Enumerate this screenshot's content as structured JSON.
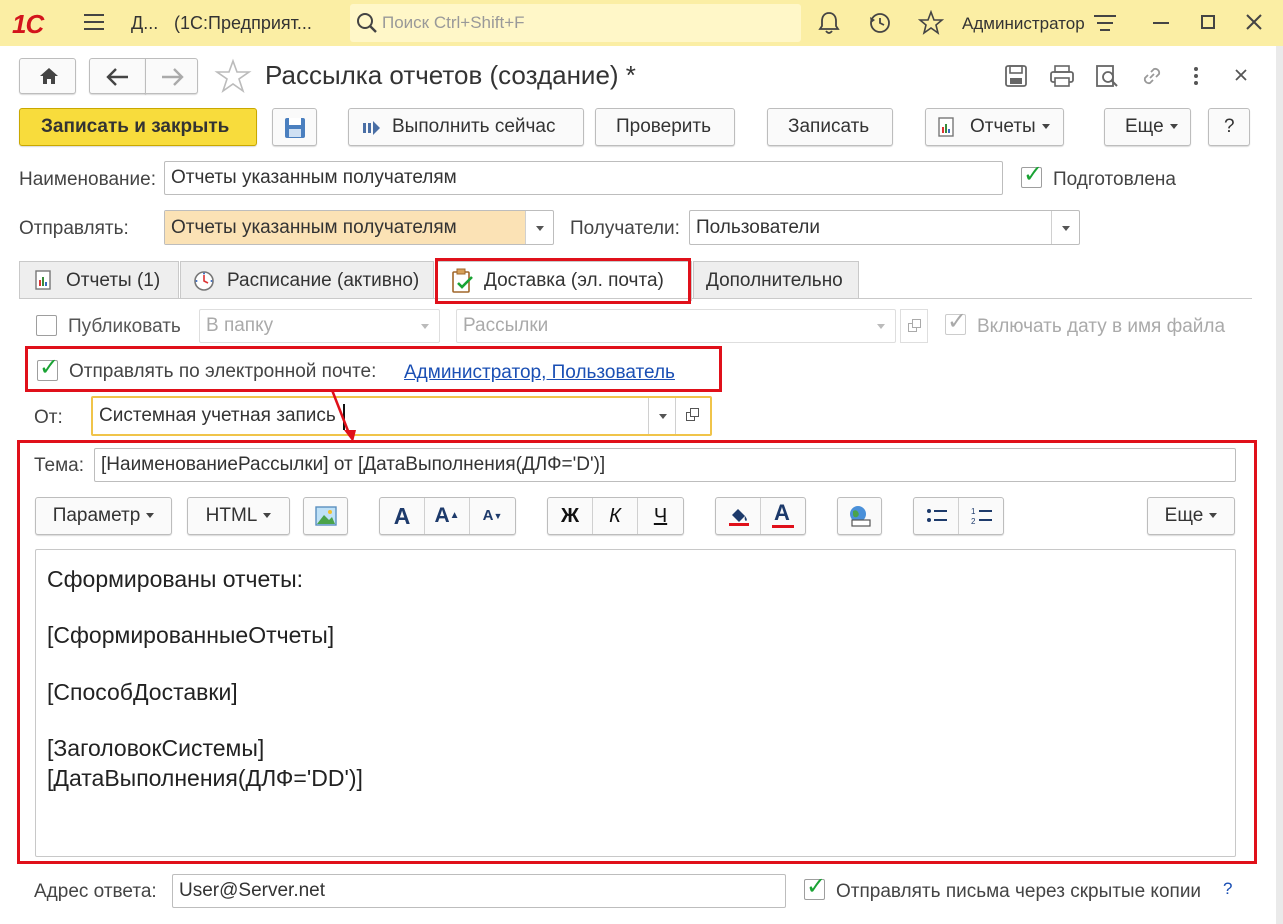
{
  "titlebar": {
    "logo": "1С",
    "short_title": "Д...",
    "app_title": "(1С:Предприят...",
    "search_placeholder": "Поиск Ctrl+Shift+F",
    "user": "Администратор"
  },
  "form": {
    "title": "Рассылка отчетов (создание) *",
    "toolbar": {
      "save_close": "Записать и закрыть",
      "run_now": "Выполнить сейчас",
      "check": "Проверить",
      "save": "Записать",
      "reports": "Отчеты",
      "more": "Еще",
      "help": "?"
    },
    "name_label": "Наименование:",
    "name_value": "Отчеты указанным получателям",
    "prepared_label": "Подготовлена",
    "send_label": "Отправлять:",
    "send_value": "Отчеты указанным получателям",
    "recipients_label": "Получатели:",
    "recipients_value": "Пользователи",
    "tabs": [
      {
        "label": "Отчеты (1)"
      },
      {
        "label": "Расписание (активно)"
      },
      {
        "label": "Доставка (эл. почта)"
      },
      {
        "label": "Дополнительно"
      }
    ],
    "publish_label": "Публиковать",
    "folder_value": "В папку",
    "mailings_value": "Рассылки",
    "include_date_label": "Включать дату в имя файла",
    "email_label": "Отправлять по электронной почте:",
    "email_recipients_link": "Администратор, Пользователь",
    "from_label": "От:",
    "from_value": "Системная учетная запись",
    "subject_label": "Тема:",
    "subject_value": "[НаименованиеРассылки] от [ДатаВыполнения(ДЛФ='D')]",
    "editor_toolbar": {
      "param": "Параметр",
      "html": "HTML",
      "bold": "Ж",
      "italic": "К",
      "underline": "Ч",
      "more": "Еще",
      "font_a": "A",
      "font_inc": "A",
      "font_dec": "A",
      "list_num_label": "1 2"
    },
    "body_lines": [
      "Сформированы отчеты:",
      "[СформированныеОтчеты]",
      "[СпособДоставки]",
      "[ЗаголовокСистемы]",
      "[ДатаВыполнения(ДЛФ='DD')]"
    ],
    "reply_label": "Адрес ответа:",
    "reply_value": "User@Server.net",
    "bcc_label": "Отправлять письма через скрытые копии",
    "bcc_help": "?"
  },
  "colors": {
    "titlebar_bg": "#fbeea4",
    "accent_button": "#f8dc3c",
    "highlight_red": "#e0101a",
    "link": "#1a4fb4",
    "check_green": "#1aa334"
  }
}
